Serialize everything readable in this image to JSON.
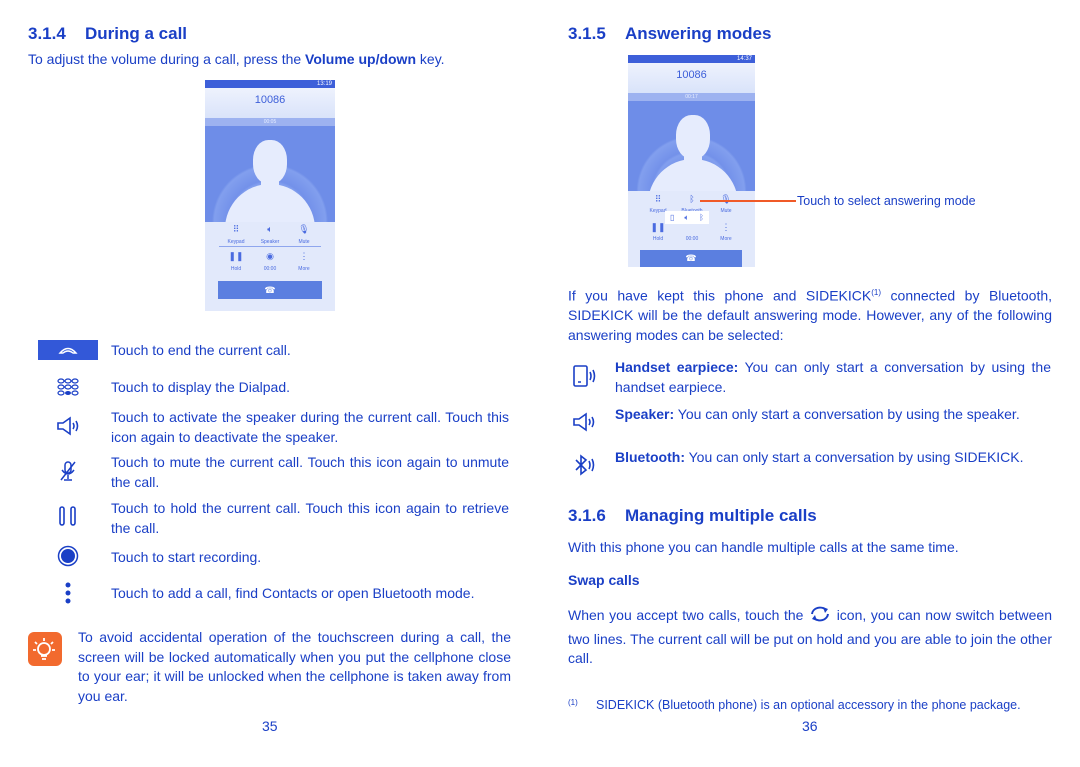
{
  "left": {
    "section_num": "3.1.4",
    "section_title": "During a call",
    "intro_pre": "To adjust the volume during a call, press the ",
    "intro_bold": "Volume up/down",
    "intro_post": " key.",
    "phone": {
      "status_time": "13:19",
      "number": "10086",
      "timer": "00:05",
      "labels": [
        "Keypad",
        "Speaker",
        "Mute",
        "Hold",
        "00:00",
        "More"
      ]
    },
    "items": [
      {
        "icon": "end-call-icon",
        "text": "Touch to end the current call."
      },
      {
        "icon": "dialpad-icon",
        "text": "Touch to display the Dialpad."
      },
      {
        "icon": "speaker-icon",
        "text": "Touch to activate the speaker during the current call. Touch this icon again to deactivate the speaker."
      },
      {
        "icon": "mute-icon",
        "text": "Touch to mute the current call. Touch this icon again to unmute the call."
      },
      {
        "icon": "hold-icon",
        "text": "Touch to hold the current call. Touch this icon again to retrieve the call."
      },
      {
        "icon": "record-icon",
        "text": "Touch to start recording."
      },
      {
        "icon": "more-icon",
        "text": "Touch to add a call, find Contacts or open Bluetooth mode."
      }
    ],
    "tip_icon": "lightbulb-icon",
    "tip": "To avoid accidental operation of the touchscreen during a call, the screen will be locked automatically when you put the cellphone close to your ear; it will be unlocked when the cellphone is taken away from you ear.",
    "page_number": "35"
  },
  "right": {
    "section_num": "3.1.5",
    "section_title": "Answering modes",
    "phone": {
      "status_time": "14:37",
      "number": "10086",
      "timer": "00:17",
      "labels": [
        "Keypad",
        "Bluetooth",
        "Mute",
        "Hold",
        "00:00",
        "More"
      ]
    },
    "callout": "Touch to select answering mode",
    "para1_a": "If you have kept this phone and SIDEKICK",
    "para1_sup": "(1)",
    "para1_b": " connected by Bluetooth, SIDEKICK will be the default answering mode. However, any of the following answering modes can be selected:",
    "modes": [
      {
        "icon": "handset-earpiece-icon",
        "bold": "Handset  earpiece:",
        "text": " You can only start a conversation by using the handset earpiece."
      },
      {
        "icon": "speaker-icon",
        "bold": "Speaker:",
        "text": " You can only start a conversation by using the speaker."
      },
      {
        "icon": "bluetooth-icon",
        "bold": "Bluetooth:",
        "text": " You can only start a conversation by using SIDEKICK."
      }
    ],
    "section2_num": "3.1.6",
    "section2_title": "Managing multiple calls",
    "para2": "With this phone you can handle multiple calls at the same time.",
    "swap_heading": "Swap calls",
    "swap_pre": "When you accept two calls, touch the ",
    "swap_post": " icon, you can now switch between two lines. The current call will be put on hold and you are able to join the other call.",
    "footnote_mark": "(1)",
    "footnote": "SIDEKICK (Bluetooth phone) is an optional accessory in the phone package.",
    "page_number": "36"
  },
  "colors": {
    "text": "#1a3fc6",
    "phone_blue": "#5b7fe0",
    "callout_line": "#f05a28",
    "tip_bg": "#f26a2e"
  }
}
